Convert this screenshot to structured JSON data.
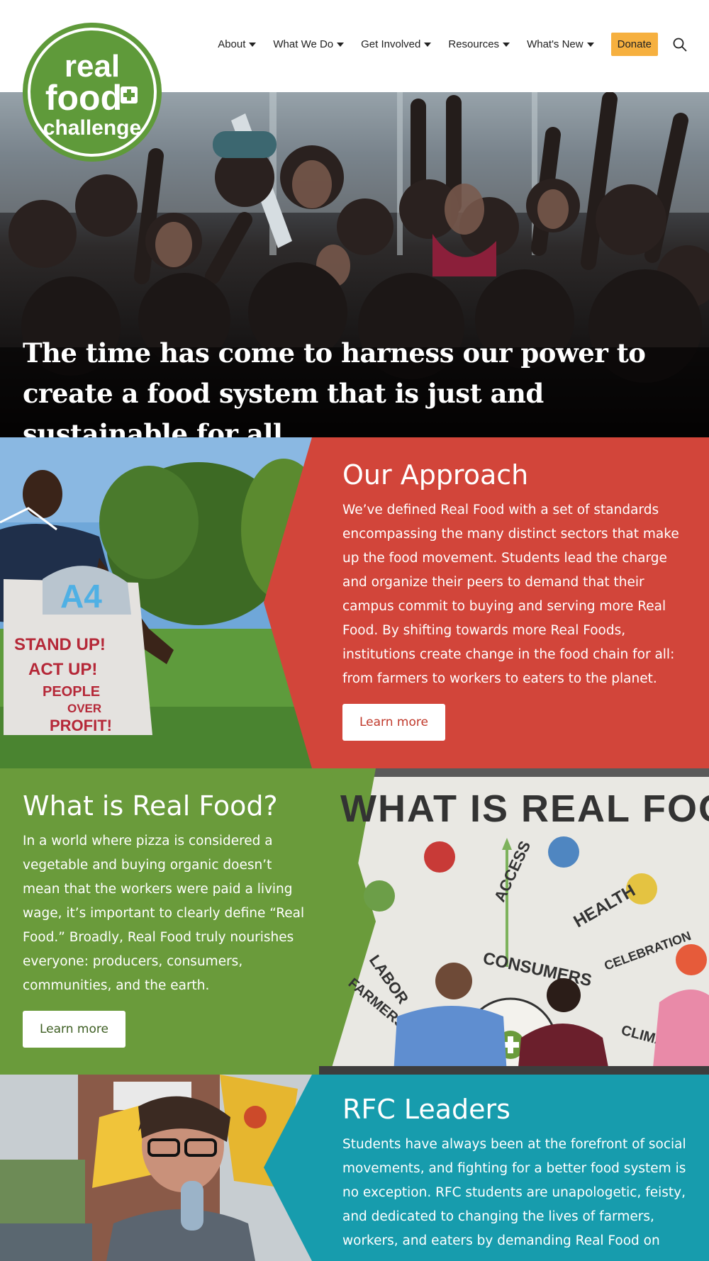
{
  "logo": {
    "line1": "real",
    "line2": "food",
    "line3": "challenge"
  },
  "nav": {
    "items": [
      {
        "label": "About"
      },
      {
        "label": "What We Do"
      },
      {
        "label": "Get Involved"
      },
      {
        "label": "Resources"
      },
      {
        "label": "What's New"
      }
    ],
    "donate": "Donate"
  },
  "hero": {
    "headline": "The time has come to harness our power to create a food system that is just and sustainable for all."
  },
  "approach": {
    "title": "Our Approach",
    "body": "We’ve defined Real Food with a set of standards encompassing the many distinct sectors that make up the food movement. Students lead the charge and organize their peers to demand that their campus commit to buying and serving more Real Food. By shifting towards more Real Foods, institutions create change in the food chain for all: from farmers to workers to eaters to the planet.",
    "button": "Learn more",
    "sign_lines": [
      "STAND UP!",
      "ACT UP!",
      "PEOPLE",
      "OVER",
      "PROFIT!"
    ]
  },
  "realfood": {
    "title": "What is Real Food?",
    "body": "In a world where pizza is considered a vegetable and buying organic doesn’t mean that the workers were paid a living wage, it’s important to clearly define “Real Food.” Broadly, Real Food truly nourishes everyone: producers, consumers, communities, and the earth.",
    "button": "Learn more",
    "banner_words": {
      "headline": "WHAT IS REAL FOOD",
      "access": "ACCESS",
      "health": "HEALTH",
      "labor": "LABOR",
      "celebration": "CELEBRATION",
      "consumers": "CONSUMERS",
      "farmers": "FARMERS",
      "climate": "CLIMATE"
    }
  },
  "leaders": {
    "title": "RFC Leaders",
    "body": "Students have always been at the forefront of social movements, and fighting for a better food system is no exception. RFC students are unapologetic, feisty, and dedicated to changing the lives of farmers, workers, and eaters by demanding Real Food on"
  },
  "colors": {
    "approach_bg": "#d2453a",
    "realfood_bg": "#6a9b3b",
    "leaders_bg": "#179cad",
    "logo_green": "#5f9a3a",
    "donate_bg": "#f6b03f"
  },
  "icons": [
    "caret-down-icon",
    "search-icon",
    "plus-icon"
  ]
}
